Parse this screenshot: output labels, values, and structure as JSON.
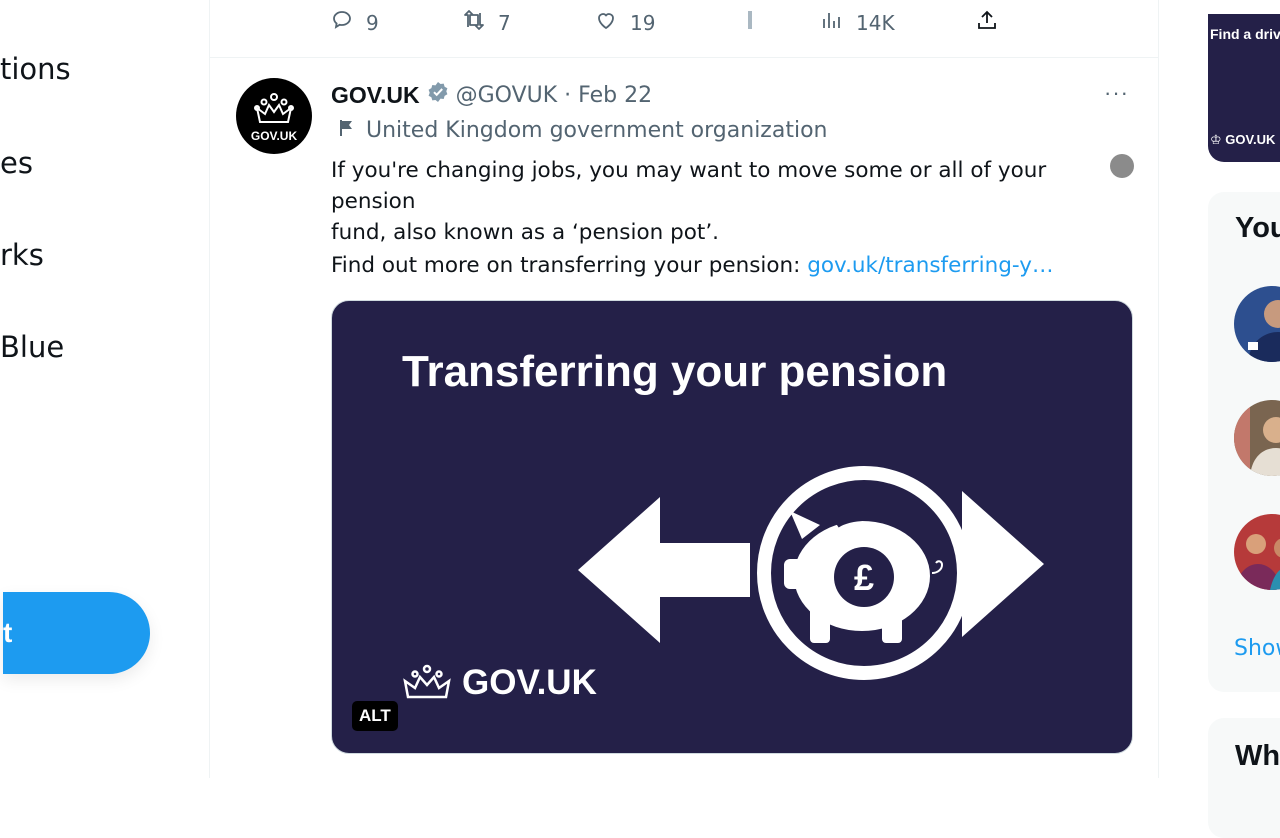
{
  "left_nav": {
    "items": [
      {
        "label": "tions"
      },
      {
        "label": "es"
      },
      {
        "label": "rks"
      },
      {
        "label": "Blue"
      }
    ],
    "post_button_label": "t"
  },
  "tweet_top_actions": {
    "reply_count": "9",
    "retweet_count": "7",
    "like_count": "19",
    "views_count": "14K"
  },
  "tweet": {
    "display_name": "GOV.UK",
    "handle_date": "@GOVUK · Feb 22",
    "affiliation": "United Kingdom government organization",
    "avatar_label": "GOV.UK",
    "text_line_1": "If you're changing jobs, you may want to move some or all of your pension",
    "text_line_2": "fund, also known as a ‘pension pot’.",
    "text_prefix": "Find out more on transferring your pension: ",
    "link_text": "gov.uk/transferring-y…",
    "more_label": "···",
    "media": {
      "title": "Transferring your pension",
      "brand": "GOV.UK",
      "alt_badge": "ALT"
    }
  },
  "right_sidebar": {
    "promo_text": "Find a driv",
    "promo_brand": "GOV.UK",
    "panel_1_title": "You",
    "show_more": "Show",
    "panel_2_title": "Wh"
  },
  "colors": {
    "accent": "#1d9bf0",
    "card_navy": "#242048",
    "muted": "#536471"
  }
}
